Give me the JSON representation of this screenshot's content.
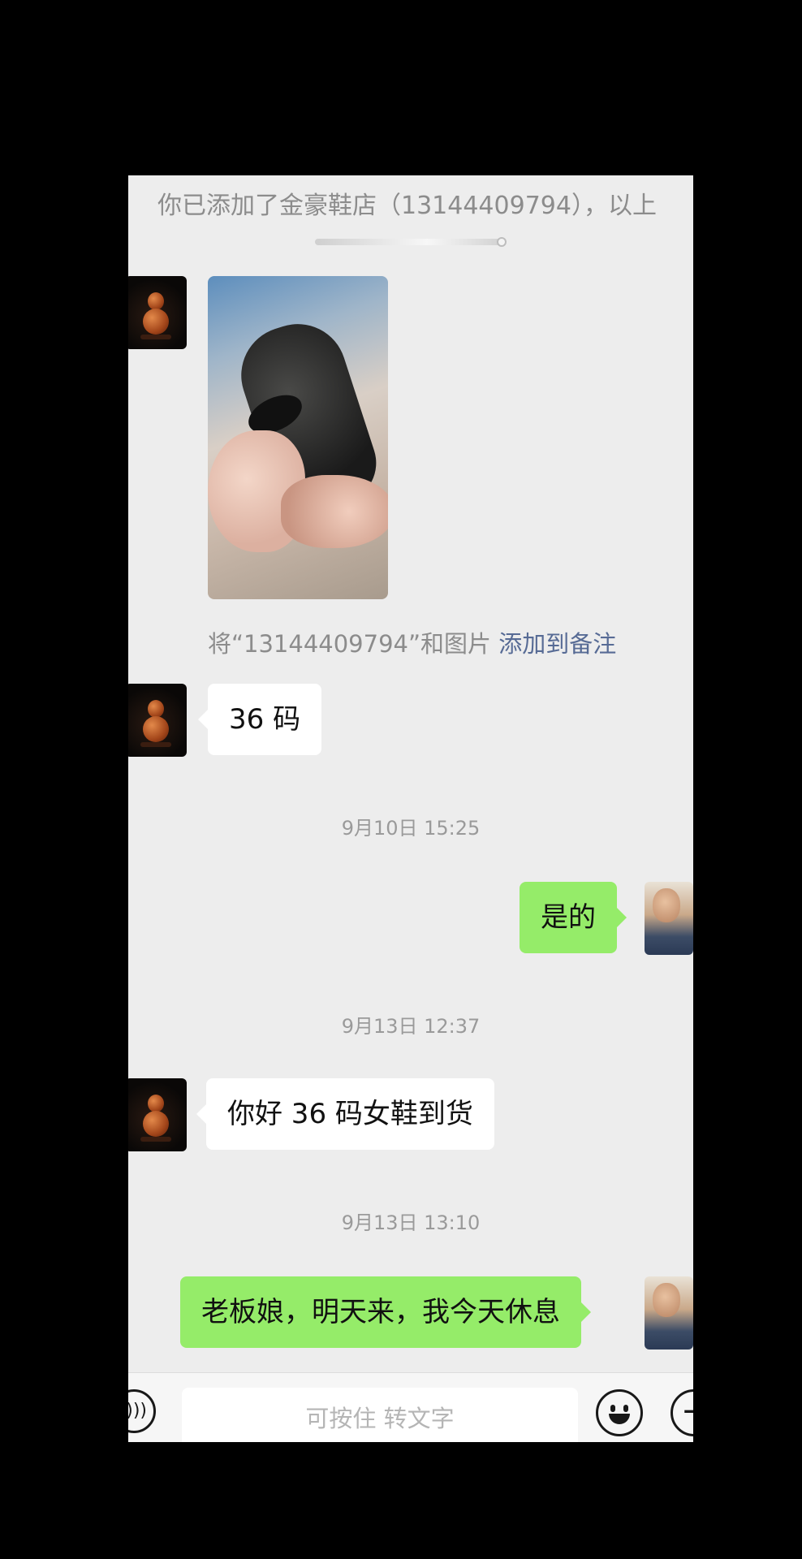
{
  "system_note": {
    "text": "你已添加了金豪鞋店（13144409794），以上"
  },
  "photo_note": {
    "prefix": "将“13144409794”和图片",
    "link": "添加到备注"
  },
  "messages": [
    {
      "from": "them",
      "text": "36 码"
    },
    {
      "timestamp": "9月10日 15:25"
    },
    {
      "from": "me",
      "text": "是的"
    },
    {
      "timestamp": "9月13日 12:37"
    },
    {
      "from": "them",
      "text": "你好 36 码女鞋到货"
    },
    {
      "timestamp": "9月13日 13:10"
    },
    {
      "from": "me",
      "text": "老板娘，明天来，我今天休息"
    }
  ],
  "input_bar": {
    "placeholder": "可按住 转文字",
    "voice_icon": "voice-icon",
    "emoji_icon": "emoji-icon",
    "plus_icon": "plus-icon"
  },
  "colors": {
    "chat_background": "#ededed",
    "outgoing_bubble": "#95ec69",
    "incoming_bubble": "#ffffff",
    "link": "#576b95"
  }
}
